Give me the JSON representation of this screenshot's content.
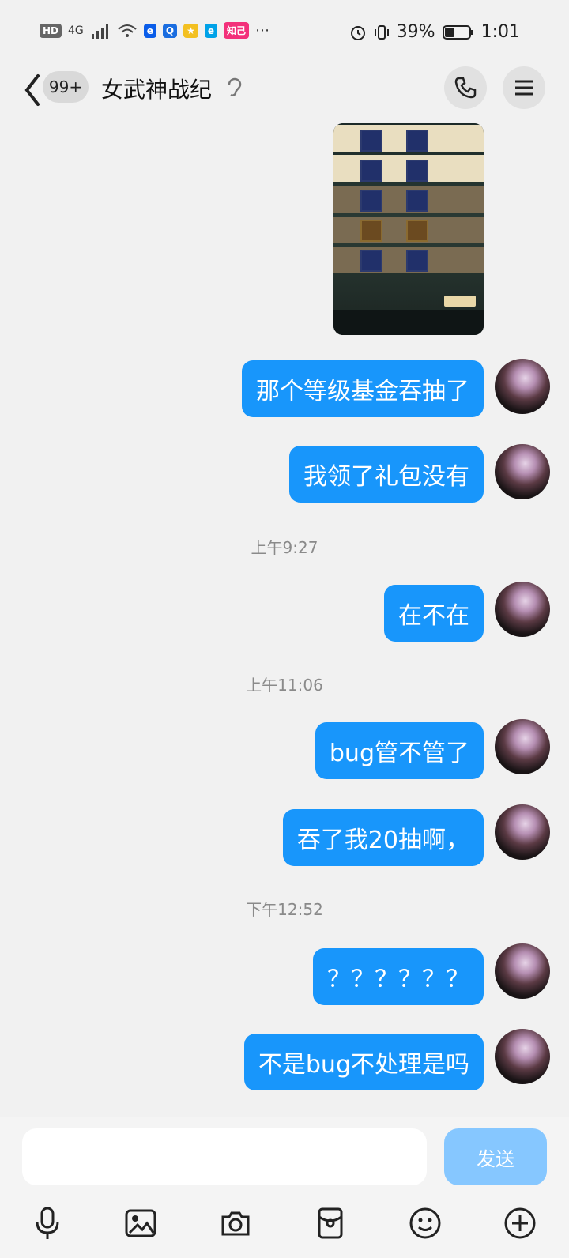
{
  "status_bar": {
    "left": {
      "hd": "HD",
      "network": "4G",
      "app_chip": "知己"
    },
    "right": {
      "battery_percent": "39%",
      "time": "1:01"
    }
  },
  "header": {
    "unread_badge": "99+",
    "title": "女武神战纪"
  },
  "messages": [
    {
      "text": "那个等级基金吞抽了"
    },
    {
      "text": "我领了礼包没有"
    },
    {
      "text": "在不在"
    },
    {
      "text": "bug管不管了"
    },
    {
      "text": "吞了我20抽啊，"
    },
    {
      "text": "？？？？？？"
    },
    {
      "text": "不是bug不处理是吗"
    }
  ],
  "timestamps": [
    "上午9:27",
    "上午11:06",
    "下午12:52"
  ],
  "composer": {
    "send_label": "发送"
  },
  "icons": {
    "status_left": [
      "hd-icon",
      "signal-icon",
      "wifi-icon",
      "app-icon",
      "app-icon",
      "app-icon",
      "app-icon",
      "app-icon",
      "more-icon"
    ],
    "status_right": [
      "alarm-icon",
      "vibrate-icon",
      "battery-icon"
    ],
    "header": [
      "back-chevron-icon",
      "ear-icon",
      "phone-icon",
      "menu-icon"
    ],
    "toolbar": [
      "microphone-icon",
      "image-icon",
      "camera-icon",
      "red-packet-icon",
      "emoji-icon",
      "plus-icon"
    ]
  },
  "colors": {
    "bubble": "#1896FB",
    "send_disabled": "#86C7FF",
    "background": "#F1F1F1"
  }
}
